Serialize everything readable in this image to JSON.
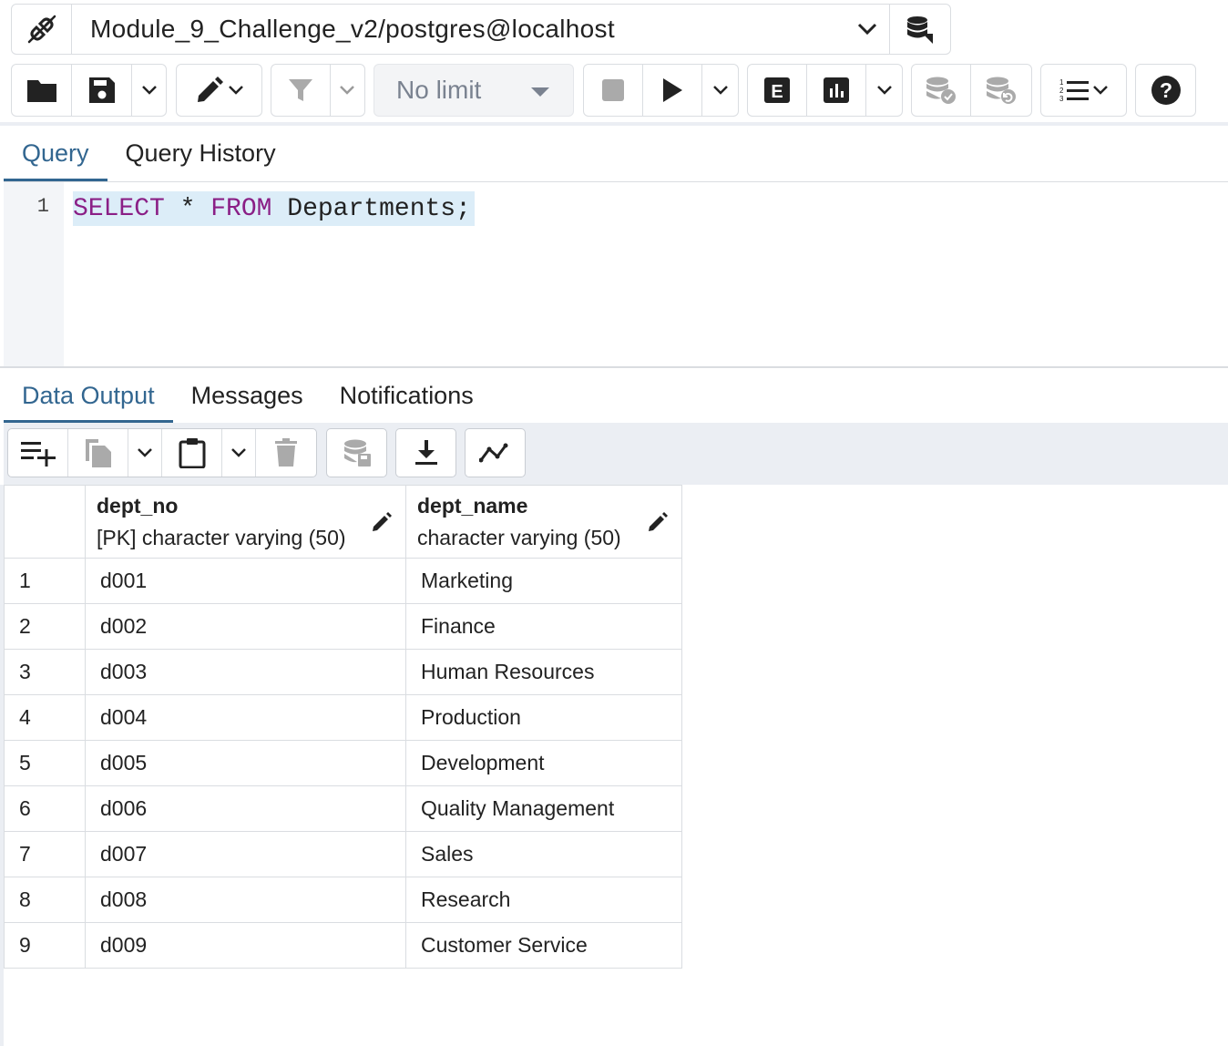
{
  "connection": {
    "name": "Module_9_Challenge_v2/postgres@localhost",
    "status_icon": "connection-plug-icon",
    "new_connection_icon": "database-add-icon"
  },
  "toolbar": {
    "limit_value": "No limit",
    "icons": [
      "folder-open-icon",
      "save-icon",
      "chevron-down-icon",
      "edit-pencil-icon",
      "filter-icon",
      "chevron-down-icon",
      "stop-icon",
      "play-execute-icon",
      "chevron-down-icon",
      "explain-icon",
      "explain-analyze-icon",
      "chevron-down-icon",
      "commit-icon",
      "rollback-icon",
      "macros-list-icon",
      "help-icon"
    ]
  },
  "query_tabs": [
    {
      "label": "Query",
      "active": true
    },
    {
      "label": "Query History",
      "active": false
    }
  ],
  "editor": {
    "line_number": "1",
    "tokens": {
      "kw1": "SELECT",
      "star": " * ",
      "kw2": "FROM",
      "rest": " Departments;"
    }
  },
  "output_tabs": [
    {
      "label": "Data Output",
      "active": true
    },
    {
      "label": "Messages",
      "active": false
    },
    {
      "label": "Notifications",
      "active": false
    }
  ],
  "grid": {
    "columns": [
      {
        "name": "dept_no",
        "type": "[PK] character varying (50)"
      },
      {
        "name": "dept_name",
        "type": "character varying (50)"
      }
    ],
    "rows": [
      {
        "n": "1",
        "dept_no": "d001",
        "dept_name": "Marketing"
      },
      {
        "n": "2",
        "dept_no": "d002",
        "dept_name": "Finance"
      },
      {
        "n": "3",
        "dept_no": "d003",
        "dept_name": "Human Resources"
      },
      {
        "n": "4",
        "dept_no": "d004",
        "dept_name": "Production"
      },
      {
        "n": "5",
        "dept_no": "d005",
        "dept_name": "Development"
      },
      {
        "n": "6",
        "dept_no": "d006",
        "dept_name": "Quality Management"
      },
      {
        "n": "7",
        "dept_no": "d007",
        "dept_name": "Sales"
      },
      {
        "n": "8",
        "dept_no": "d008",
        "dept_name": "Research"
      },
      {
        "n": "9",
        "dept_no": "d009",
        "dept_name": "Customer Service"
      }
    ]
  },
  "colors": {
    "accent": "#326690",
    "keyword": "#8a1f86",
    "selection": "#dcedf8"
  }
}
